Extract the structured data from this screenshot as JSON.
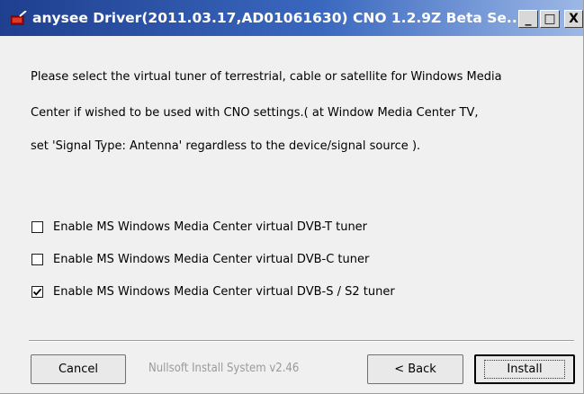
{
  "window": {
    "title": "anysee Driver(2011.03.17,AD01061630) CNO 1.2.9Z Beta Se...",
    "controls": {
      "minimize": "_",
      "maximize": "□",
      "close": "X"
    }
  },
  "description": {
    "line1": "Please select the virtual tuner of terrestrial, cable or satellite for Windows Media",
    "line2": "Center if wished to be used with CNO settings.( at Window Media Center TV,",
    "line3": "set 'Signal Type: Antenna' regardless to the device/signal source )."
  },
  "options": [
    {
      "label": "Enable MS Windows Media Center virtual DVB-T tuner",
      "checked": false
    },
    {
      "label": "Enable MS Windows Media Center virtual DVB-C tuner",
      "checked": false
    },
    {
      "label": "Enable MS Windows Media Center virtual DVB-S / S2 tuner",
      "checked": true
    }
  ],
  "footer": {
    "branding": "Nullsoft Install System v2.46",
    "cancel_label": "Cancel",
    "back_label": "< Back",
    "install_label": "Install"
  },
  "colors": {
    "titlebar_start": "#1f3f8f",
    "titlebar_end": "#9db8e6",
    "window_bg": "#f0f0f0"
  },
  "icons": {
    "app": "driver-installer-icon"
  }
}
